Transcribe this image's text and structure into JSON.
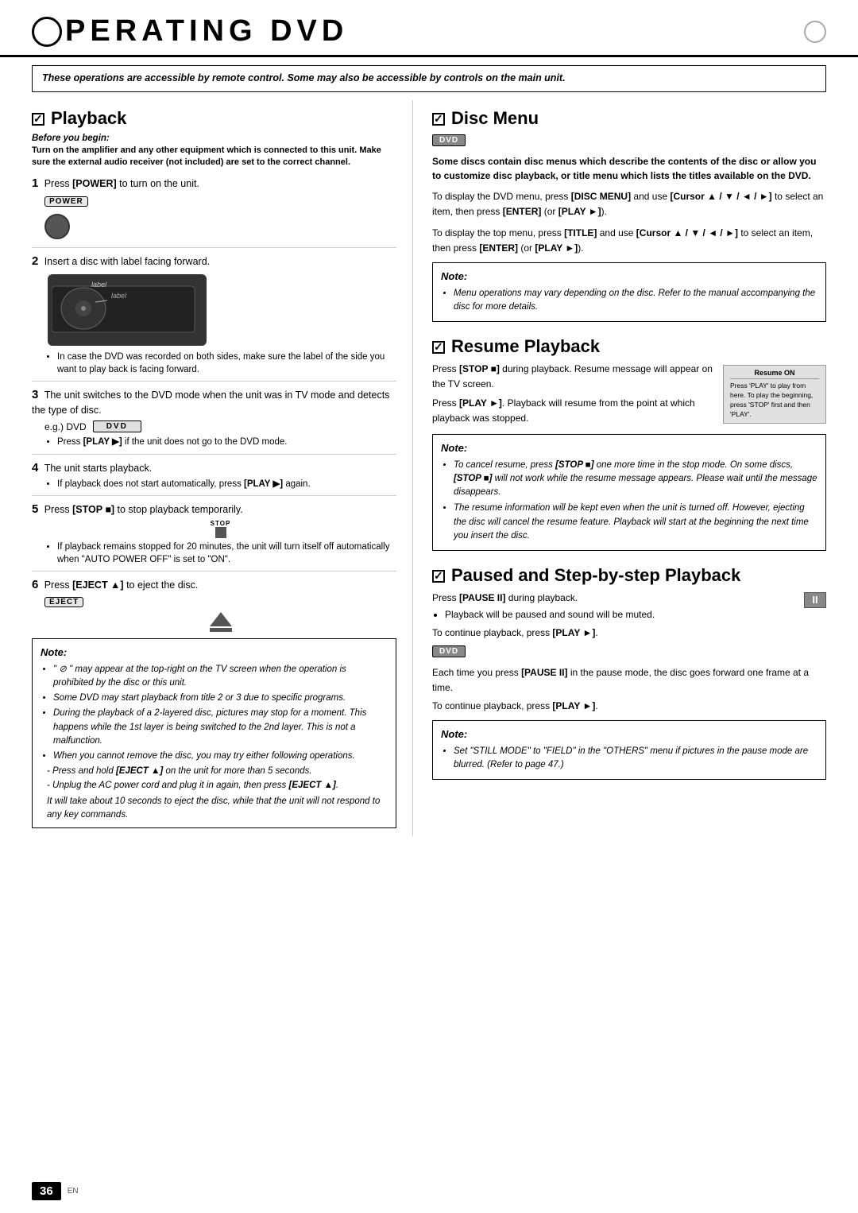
{
  "header": {
    "title": "PERATING   DVD",
    "o_letter": "O"
  },
  "intro": {
    "text": "These operations are accessible by remote control. Some may also be accessible by controls on the main unit."
  },
  "playback": {
    "heading": "Playback",
    "before_begin_label": "Before you begin:",
    "before_begin_text": "Turn on the amplifier and any other equipment which is connected to this unit. Make sure the external audio receiver (not included) are set to the correct channel.",
    "steps": [
      {
        "num": "1",
        "text": "Press [POWER] to turn on the unit."
      },
      {
        "num": "2",
        "text": "Insert a disc with label facing forward.",
        "sub": "label"
      },
      {
        "num": "",
        "bullets": [
          "In case the DVD was recorded on both sides, make sure the label of the side you want to play back is facing forward."
        ]
      },
      {
        "num": "3",
        "text": "The unit switches to the DVD mode when the unit was in TV mode and detects the type of disc.",
        "eg": "e.g.) DVD",
        "sub_bullet": "Press [PLAY ▶] if the unit does not go to the DVD mode."
      },
      {
        "num": "4",
        "text": "The unit starts playback.",
        "sub_bullet": "If playback does not start automatically, press [PLAY ▶] again."
      },
      {
        "num": "5",
        "text": "Press [STOP ■] to stop playback temporarily.",
        "sub_bullets": [
          "If playback remains stopped for 20 minutes, the unit will turn itself off automatically when \"AUTO POWER OFF\" is set to \"ON\"."
        ]
      },
      {
        "num": "6",
        "text": "Press [EJECT ▲] to eject the disc."
      }
    ],
    "note": {
      "title": "Note:",
      "bullets": [
        "\" ⊘ \" may appear at the top-right on the TV screen when the operation is prohibited by the disc or this unit.",
        "Some DVD may start playback from title 2 or 3 due to specific programs.",
        "During the playback of a 2-layered disc, pictures may stop for a moment. This happens while the 1st layer is being switched to the 2nd layer. This is not a malfunction.",
        "When you cannot remove the disc, you may try either following operations.",
        "- Press and hold [EJECT ▲] on the unit for more than 5 seconds.",
        "- Unplug the AC power cord and plug it in again, then press [EJECT ▲].",
        "It will take about 10 seconds to eject the disc, while that the unit will not respond to any key commands."
      ]
    }
  },
  "disc_menu": {
    "heading": "Disc Menu",
    "dvd_badge": "DVD",
    "intro": "Some discs contain disc menus which describe the contents of the disc or allow you to customize disc playback, or title menu which lists the titles available on the DVD.",
    "para1": "To display the DVD menu, press [DISC MENU] and use [Cursor ▲ / ▼ / ◄ / ►] to select an item, then press [ENTER] (or [PLAY ►]).",
    "para2": "To display the top menu, press [TITLE] and use [Cursor ▲ / ▼ / ◄ / ►] to select an item, then press [ENTER] (or [PLAY ►]).",
    "note": {
      "title": "Note:",
      "bullets": [
        "Menu operations may vary depending on the disc. Refer to the manual accompanying the disc for more details."
      ]
    }
  },
  "resume_playback": {
    "heading": "Resume Playback",
    "para1": "Press [STOP ■] during playback. Resume message will appear on the TV screen.",
    "para2": "Press [PLAY ►]. Playback will resume from the point at which playback was stopped.",
    "resume_on_box": {
      "title": "Resume ON",
      "text": "Press 'PLAY' to play from here. To play the beginning, press 'STOP' first and then 'PLAY'."
    },
    "note": {
      "title": "Note:",
      "bullets": [
        "To cancel resume, press [STOP ■] one more time in the stop mode. On some discs, [STOP ■] will not work while the resume message appears. Please wait until the message disappears.",
        "The resume information will be kept even when the unit is turned off. However, ejecting the disc will cancel the resume feature. Playback will start at the beginning the next time you insert the disc."
      ]
    }
  },
  "paused": {
    "heading": "Paused and Step-by-step Playback",
    "dvd_badge": "DVD",
    "para1": "Press [PAUSE II] during playback.",
    "bullet1": "Playback will be paused and sound will be muted.",
    "para2": "To continue playback, press [PLAY ►].",
    "para3": "Each time you press [PAUSE II] in the pause mode, the disc goes forward one frame at a time.",
    "para4": "To continue playback, press [PLAY ►].",
    "note": {
      "title": "Note:",
      "bullets": [
        "Set \"STILL MODE\" to \"FIELD\" in the \"OTHERS\" menu if pictures in the pause mode are blurred. (Refer to page 47.)"
      ]
    }
  },
  "page_number": "36",
  "page_lang": "EN"
}
